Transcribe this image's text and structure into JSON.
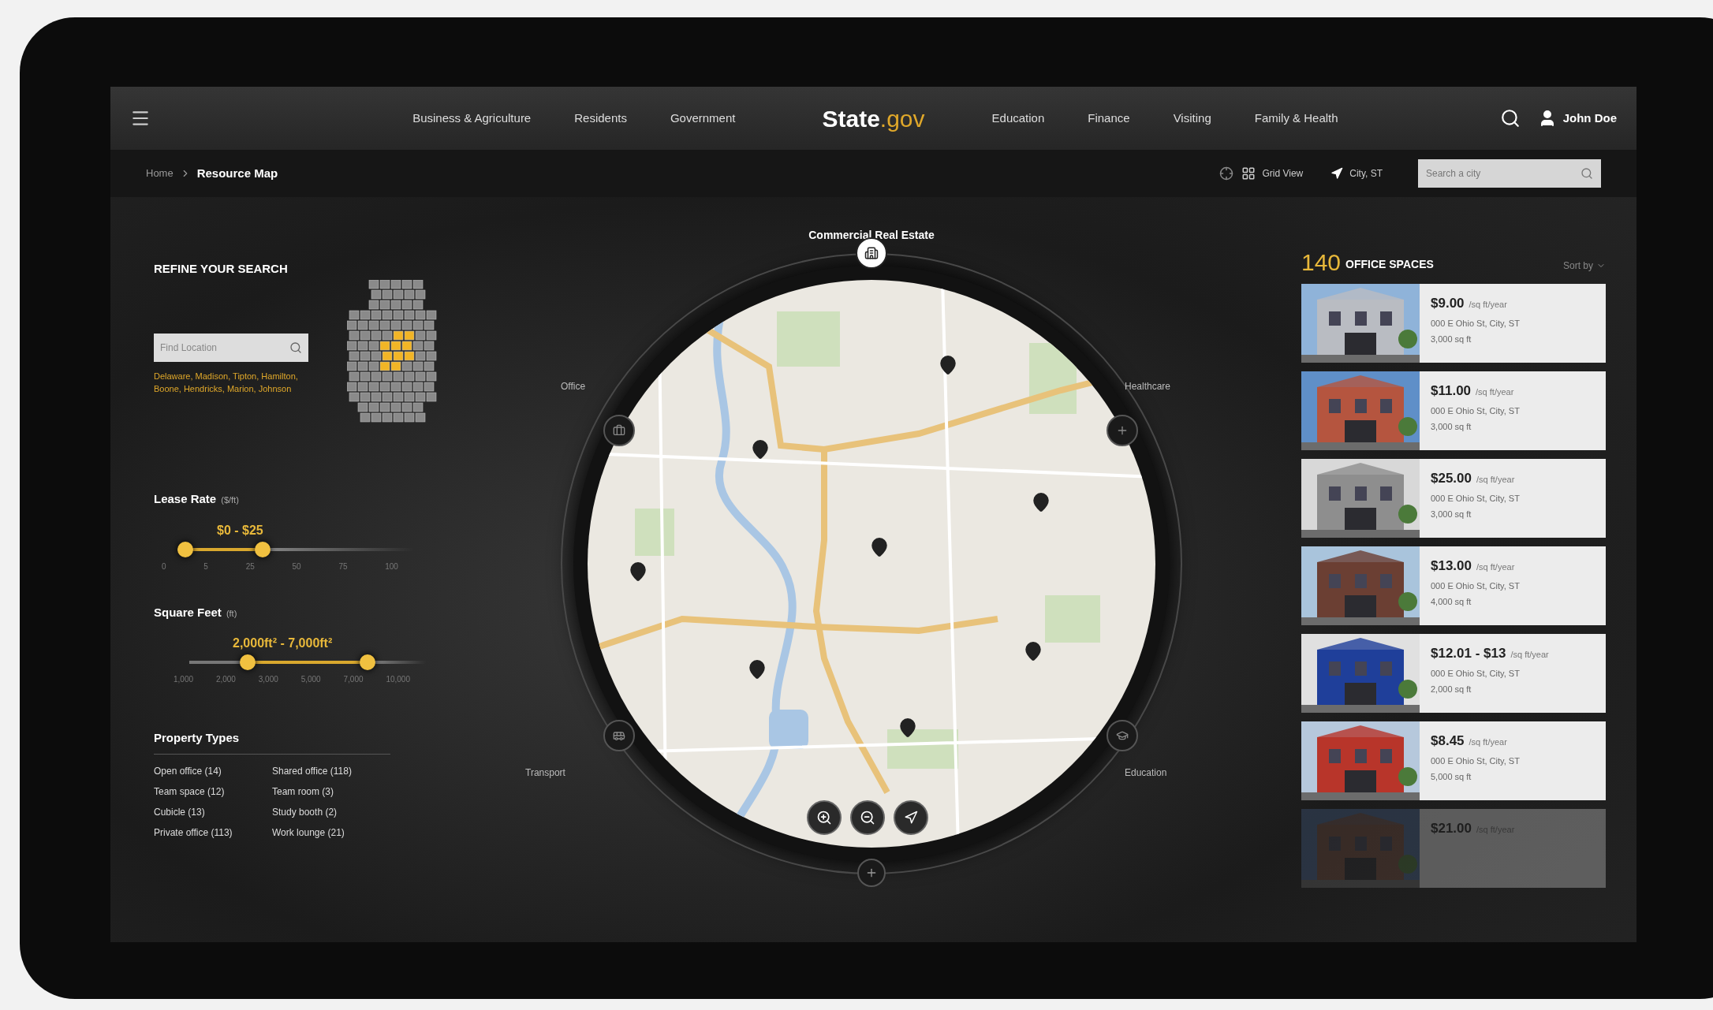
{
  "nav": {
    "links_left": [
      "Business & Agriculture",
      "Residents",
      "Government"
    ],
    "logo": {
      "name": "State",
      "suffix": ".gov"
    },
    "links_right": [
      "Education",
      "Finance",
      "Visiting",
      "Family & Health"
    ],
    "user": "John Doe"
  },
  "subbar": {
    "breadcrumb": [
      "Home",
      "Resource Map"
    ],
    "view_toggle": "Grid View",
    "location": "City, ST",
    "search": {
      "placeholder": "Search a city"
    }
  },
  "filters": {
    "title": "REFINE YOUR SEARCH",
    "location_search": {
      "placeholder": "Find Location"
    },
    "selected_counties": "Delaware, Madison, Tipton, Hamilton, Boone, Hendricks, Marion, Johnson",
    "sliders": [
      {
        "label": "Lease Rate",
        "unit": "($/ft)",
        "reading": "$0 - $25",
        "thumbs": [
          {
            "level": 0
          },
          {
            "level": 0.35
          }
        ],
        "ticks": [
          "0",
          "5",
          "25",
          "50",
          "75",
          "100"
        ]
      },
      {
        "label": "Square Feet",
        "unit": "(ft)",
        "reading": "2,000ft² - 7,000ft²",
        "thumbs": [
          {
            "level": 0.23
          },
          {
            "level": 0.77
          }
        ],
        "ticks": [
          "1,000",
          "2,000",
          "3,000",
          "5,000",
          "7,000",
          "10,000"
        ]
      }
    ],
    "property_types": {
      "title": "Property Types",
      "items": [
        "Open office (14)",
        "Shared office (118)",
        "Team space (12)",
        "Team room (3)",
        "Cubicle (13)",
        "Study booth (2)",
        "Private office (113)",
        "Work lounge (21)"
      ]
    }
  },
  "map": {
    "title": "Commercial Real Estate",
    "categories": [
      {
        "label": "Office",
        "selected": false
      },
      {
        "label": "Healthcare",
        "selected": false
      },
      {
        "label": "Transport",
        "selected": false
      },
      {
        "label": "Education",
        "selected": false
      }
    ],
    "top_selected": true
  },
  "results": {
    "count": "140",
    "label": "OFFICE SPACES",
    "sort": "Sort by",
    "listings": [
      {
        "price": "$9.00",
        "unit": "/sq ft/year",
        "address": "000 E Ohio St, City, ST",
        "size": "3,000 sq ft",
        "faded": false
      },
      {
        "price": "$11.00",
        "unit": "/sq ft/year",
        "address": "000 E Ohio St, City, ST",
        "size": "3,000 sq ft",
        "faded": false
      },
      {
        "price": "$25.00",
        "unit": "/sq ft/year",
        "address": "000 E Ohio St, City, ST",
        "size": "3,000 sq ft",
        "faded": false
      },
      {
        "price": "$13.00",
        "unit": "/sq ft/year",
        "address": "000 E Ohio St, City, ST",
        "size": "4,000 sq ft",
        "faded": false
      },
      {
        "price": "$12.01 - $13",
        "unit": "/sq ft/year",
        "address": "000 E Ohio St, City, ST",
        "size": "2,000 sq ft",
        "faded": false
      },
      {
        "price": "$8.45",
        "unit": "/sq ft/year",
        "address": "000 E Ohio St, City, ST",
        "size": "5,000 sq ft",
        "faded": false
      },
      {
        "price": "$21.00",
        "unit": "/sq ft/year",
        "faded": true
      }
    ]
  }
}
